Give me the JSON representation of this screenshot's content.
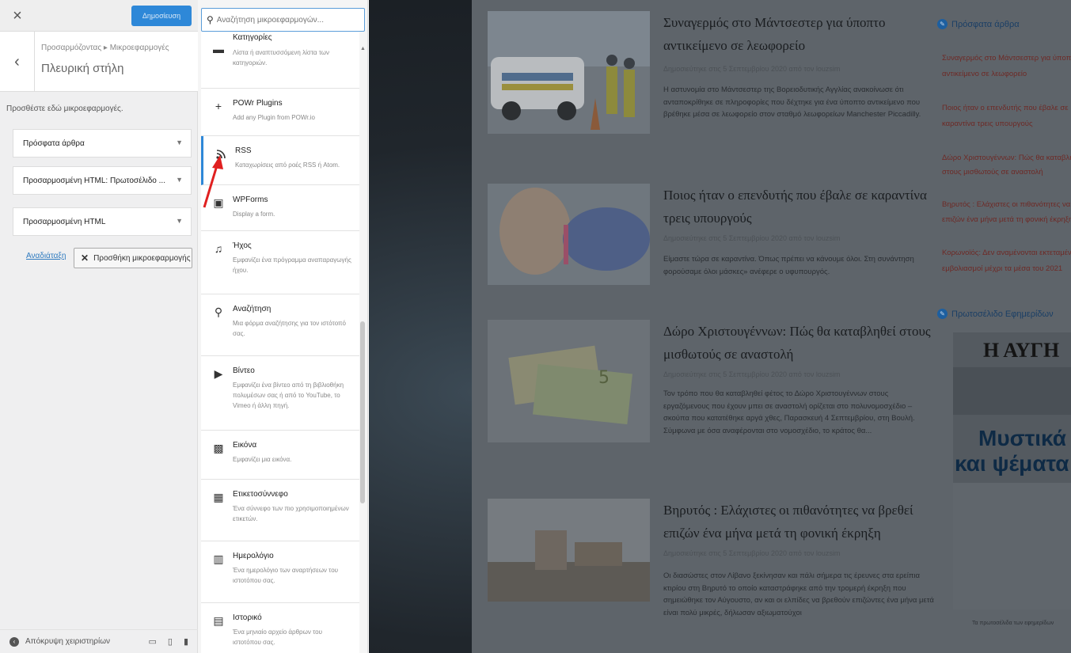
{
  "customizer": {
    "close_label": "×",
    "publish_label": "Δημοσίευση",
    "back_label": "‹",
    "breadcrumb": "Προσαρμόζοντας ▸ Μικροεφαρμογές",
    "section_title": "Πλευρική στήλη",
    "hint": "Προσθέστε εδώ μικροεφαρμογές.",
    "widgets": [
      {
        "label": "Πρόσφατα άρθρα"
      },
      {
        "label": "Προσαρμοσμένη HTML: Πρωτοσέλιδο ..."
      },
      {
        "label": "Προσαρμοσμένη HTML"
      }
    ],
    "reorder_label": "Αναδιάταξη",
    "add_widget_label": "Προσθήκη μικροεφαρμογής",
    "hide_controls_label": "Απόκρυψη χειριστηρίων"
  },
  "picker": {
    "search_placeholder": "Αναζήτηση μικροεφαρμογών...",
    "items": [
      {
        "title": "Κατηγορίες",
        "desc": "Λίστα ή αναπτυσσόμενη λίστα των κατηγοριών.",
        "icon": "folder-icon"
      },
      {
        "title": "POWr Plugins",
        "desc": "Add any Plugin from POWr.io",
        "icon": "plus-icon"
      },
      {
        "title": "RSS",
        "desc": "Καταχωρίσεις από ροές RSS ή Atom.",
        "icon": "rss-icon"
      },
      {
        "title": "WPForms",
        "desc": "Display a form.",
        "icon": "form-icon"
      },
      {
        "title": "Ήχος",
        "desc": "Εμφανίζει ένα πρόγραμμα αναπαραγωγής ήχου.",
        "icon": "music-icon"
      },
      {
        "title": "Αναζήτηση",
        "desc": "Μια φόρμα αναζήτησης για τον ιστότοπό σας.",
        "icon": "search-icon"
      },
      {
        "title": "Βίντεο",
        "desc": "Εμφανίζει ένα βίντεο από τη βιβλιοθήκη πολυμέσων σας ή από το YouTube, το Vimeo ή άλλη πηγή.",
        "icon": "video-icon"
      },
      {
        "title": "Εικόνα",
        "desc": "Εμφανίζει μια εικόνα.",
        "icon": "image-icon"
      },
      {
        "title": "Ετικετοσύννεφο",
        "desc": "Ένα σύννεφο των πιο χρησιμοποιημένων ετικετών.",
        "icon": "tag-cloud-icon"
      },
      {
        "title": "Ημερολόγιο",
        "desc": "Ένα ημερολόγιο των αναρτήσεων του ιστοτόπου σας.",
        "icon": "calendar-icon"
      },
      {
        "title": "Ιστορικό",
        "desc": "Ένα μηνιαίο αρχείο άρθρων του ιστοτόπου σας.",
        "icon": "archive-icon"
      }
    ]
  },
  "preview": {
    "posts": [
      {
        "title": "Συναγερμός στο Μάντσεστερ για ύποπτο αντικείμενο σε λεωφορείο",
        "meta": "Δημοσιεύτηκε στις 5 Σεπτεμβρίου 2020 από τον louzsim",
        "excerpt": "Η αστυνομία στο Μάντσεστερ της Βορειοδυτικής Αγγλίας ανακοίνωσε ότι ανταποκρίθηκε σε πληροφορίες που δέχτηκε για ένα ύποπτο αντικείμενο που βρέθηκε μέσα σε λεωφορείο στον σταθμό λεωφορείων Manchester Piccadilly."
      },
      {
        "title": "Ποιος ήταν ο επενδυτής που έβαλε σε καραντίνα τρεις υπουργούς",
        "meta": "Δημοσιεύτηκε στις 5 Σεπτεμβρίου 2020 από τον louzsim",
        "excerpt": "Είμαστε τώρα σε καραντίνα. Όπως πρέπει να κάνουμε όλοι. Στη συνάντηση φορούσαμε όλοι μάσκες» ανέφερε ο υφυπουργός."
      },
      {
        "title": "Δώρο Χριστουγέννων: Πώς θα καταβληθεί στους μισθωτούς σε αναστολή",
        "meta": "Δημοσιεύτηκε στις 5 Σεπτεμβρίου 2020 από τον louzsim",
        "excerpt": "Τον τρόπο που θα καταβληθεί φέτος το Δώρο Χριστουγέννων στους εργαζόμενους που έχουν μπει σε αναστολή ορίζεται στο πολυνομοσχέδιο – σκούπα που κατατέθηκε αργά χθες, Παρασκευή 4 Σεπτεμβρίου, στη Βουλή. Σύμφωνα με όσα αναφέρονται στο νομοσχέδιο, το κράτος θα..."
      },
      {
        "title": "Βηρυτός : Ελάχιστες οι πιθανότητες να βρεθεί επιζών ένα μήνα μετά τη φονική έκρηξη",
        "meta": "Δημοσιεύτηκε στις 5 Σεπτεμβρίου 2020 από τον louzsim",
        "excerpt": "Οι διασώστες στον Λίβανο ξεκίνησαν και πάλι σήμερα τις έρευνες στα ερείπια κτιρίου στη Βηρυτό το οποίο καταστράφηκε από την τρομερή έκρηξη που σημειώθηκε τον Αύγουστο, αν και οι ελπίδες να βρεθούν επιζώντες ένα μήνα μετά είναι πολύ μικρές, δήλωσαν αξιωματούχοι"
      }
    ],
    "sidebar": {
      "recent_heading": "Πρόσφατα άρθρα",
      "recent_links": [
        "Συναγερμός στο Μάντσεστερ για ύποπτο",
        "αντικείμενο σε λεωφορείο",
        "Ποιος ήταν ο επενδυτής που έβαλε σε",
        "καραντίνα τρεις υπουργούς",
        "Δώρο Χριστουγέννων: Πώς θα καταβληθεί",
        "στους μισθωτούς σε αναστολή",
        "Βηρυτός : Ελάχιστες οι πιθανότητες να βρεθεί",
        "επιζών ένα μήνα μετά τη φονική έκρηξη",
        "Κορωνοϊός: Δεν αναμένονται εκτεταμένοι",
        "εμβολιασμοί μέχρι τα μέσα του 2021"
      ],
      "frontpages_heading": "Πρωτοσέλιδο Εφημερίδων",
      "paper_masthead": "Η ΑΥΓΗ",
      "paper_headline_1": "Μυστικά",
      "paper_headline_2": "και ψέματα",
      "paper_caption": "Τα πρωτοσέλιδα των εφημερίδων"
    }
  }
}
